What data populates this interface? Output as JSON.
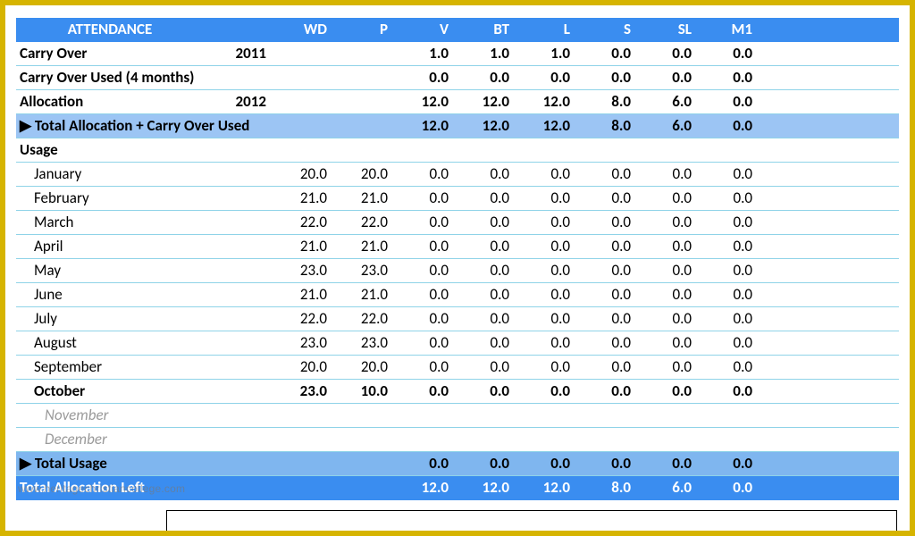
{
  "header": {
    "title": "ATTENDANCE",
    "cols": [
      "WD",
      "P",
      "V",
      "BT",
      "L",
      "S",
      "SL",
      "M1"
    ]
  },
  "carryOver": {
    "label": "Carry Over",
    "year": "2011",
    "vals": [
      "",
      "",
      "1.0",
      "1.0",
      "1.0",
      "0.0",
      "0.0",
      "0.0"
    ]
  },
  "carryOverUsed": {
    "label": "Carry Over Used (4 months)",
    "vals": [
      "",
      "",
      "0.0",
      "0.0",
      "0.0",
      "0.0",
      "0.0",
      "0.0"
    ]
  },
  "allocation": {
    "label": "Allocation",
    "year": "2012",
    "vals": [
      "",
      "",
      "12.0",
      "12.0",
      "12.0",
      "8.0",
      "6.0",
      "0.0"
    ]
  },
  "totalAllocPlus": {
    "label": "▶ Total Allocation + Carry Over Used",
    "vals": [
      "",
      "",
      "12.0",
      "12.0",
      "12.0",
      "8.0",
      "6.0",
      "0.0"
    ]
  },
  "usageHeader": "Usage",
  "months": [
    {
      "name": "January",
      "vals": [
        "20.0",
        "20.0",
        "0.0",
        "0.0",
        "0.0",
        "0.0",
        "0.0",
        "0.0"
      ]
    },
    {
      "name": "February",
      "vals": [
        "21.0",
        "21.0",
        "0.0",
        "0.0",
        "0.0",
        "0.0",
        "0.0",
        "0.0"
      ]
    },
    {
      "name": "March",
      "vals": [
        "22.0",
        "22.0",
        "0.0",
        "0.0",
        "0.0",
        "0.0",
        "0.0",
        "0.0"
      ]
    },
    {
      "name": "April",
      "vals": [
        "21.0",
        "21.0",
        "0.0",
        "0.0",
        "0.0",
        "0.0",
        "0.0",
        "0.0"
      ]
    },
    {
      "name": "May",
      "vals": [
        "23.0",
        "23.0",
        "0.0",
        "0.0",
        "0.0",
        "0.0",
        "0.0",
        "0.0"
      ]
    },
    {
      "name": "June",
      "vals": [
        "21.0",
        "21.0",
        "0.0",
        "0.0",
        "0.0",
        "0.0",
        "0.0",
        "0.0"
      ]
    },
    {
      "name": "July",
      "vals": [
        "22.0",
        "22.0",
        "0.0",
        "0.0",
        "0.0",
        "0.0",
        "0.0",
        "0.0"
      ]
    },
    {
      "name": "August",
      "vals": [
        "23.0",
        "23.0",
        "0.0",
        "0.0",
        "0.0",
        "0.0",
        "0.0",
        "0.0"
      ]
    },
    {
      "name": "September",
      "vals": [
        "20.0",
        "20.0",
        "0.0",
        "0.0",
        "0.0",
        "0.0",
        "0.0",
        "0.0"
      ]
    }
  ],
  "current": {
    "name": "October",
    "vals": [
      "23.0",
      "10.0",
      "0.0",
      "0.0",
      "0.0",
      "0.0",
      "0.0",
      "0.0"
    ]
  },
  "future": [
    {
      "name": "November"
    },
    {
      "name": "December"
    }
  ],
  "totalUsage": {
    "label": "▶ Total Usage",
    "vals": [
      "",
      "",
      "0.0",
      "0.0",
      "0.0",
      "0.0",
      "0.0",
      "0.0"
    ]
  },
  "totalLeft": {
    "label": "Total Allocation Left",
    "vals": [
      "",
      "",
      "12.0",
      "12.0",
      "12.0",
      "8.0",
      "6.0",
      "0.0"
    ]
  },
  "watermark": "www.heritagechristiancollege.com"
}
